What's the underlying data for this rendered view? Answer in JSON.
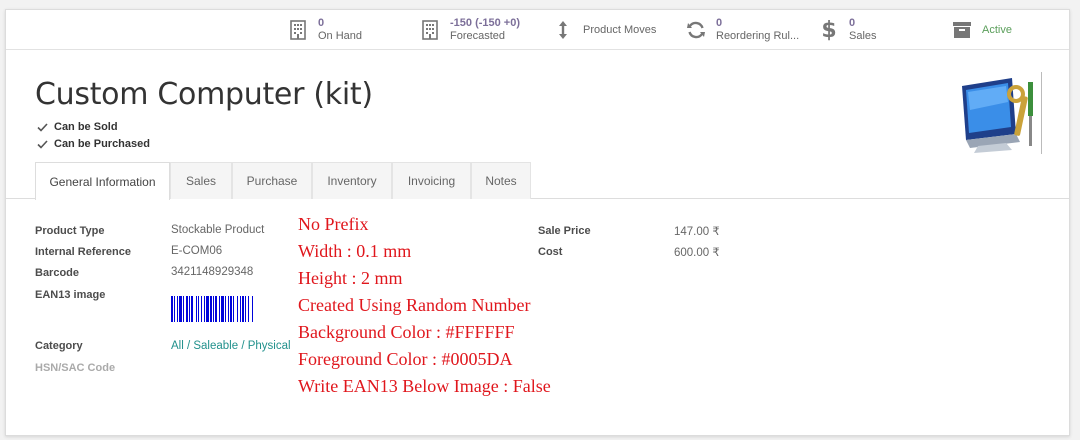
{
  "smart_buttons": {
    "on_hand": {
      "value": "0",
      "label": "On Hand"
    },
    "forecasted": {
      "value": "-150 (-150 +0)",
      "label": "Forecasted"
    },
    "product_moves": {
      "label": "Product Moves"
    },
    "reordering": {
      "value": "0",
      "label": "Reordering Rul..."
    },
    "sales": {
      "value": "0",
      "label": "Sales"
    },
    "active": {
      "label": "Active"
    }
  },
  "product": {
    "name": "Custom Computer (kit)",
    "can_be_sold": "Can be Sold",
    "can_be_purchased": "Can be Purchased",
    "image_icon": "computer-tools-icon"
  },
  "tabs": [
    "General Information",
    "Sales",
    "Purchase",
    "Inventory",
    "Invoicing",
    "Notes"
  ],
  "fields": {
    "product_type": {
      "label": "Product Type",
      "value": "Stockable Product"
    },
    "internal_reference": {
      "label": "Internal Reference",
      "value": "E-COM06"
    },
    "barcode": {
      "label": "Barcode",
      "value": "3421148929348"
    },
    "ean13_image": {
      "label": "EAN13 image"
    },
    "category": {
      "label": "Category",
      "value": "All / Saleable / Physical"
    },
    "hsn_sac": {
      "label": "HSN/SAC Code"
    },
    "sale_price": {
      "label": "Sale Price",
      "value": "147.00 ₹"
    },
    "cost": {
      "label": "Cost",
      "value": "600.00 ₹"
    }
  },
  "annotations": [
    "No Prefix",
    "Width : 0.1 mm",
    "Height : 2 mm",
    "Created Using Random Number",
    "Background Color :  #FFFFFF",
    "Foreground Color : #0005DA",
    "Write EAN13 Below Image : False"
  ],
  "colors": {
    "barcode_foreground": "#0005DA",
    "annotation_text": "#e0161c",
    "active_green": "#5a9e5a",
    "stat_purple": "#7c6f99",
    "category_link": "#21918c"
  }
}
